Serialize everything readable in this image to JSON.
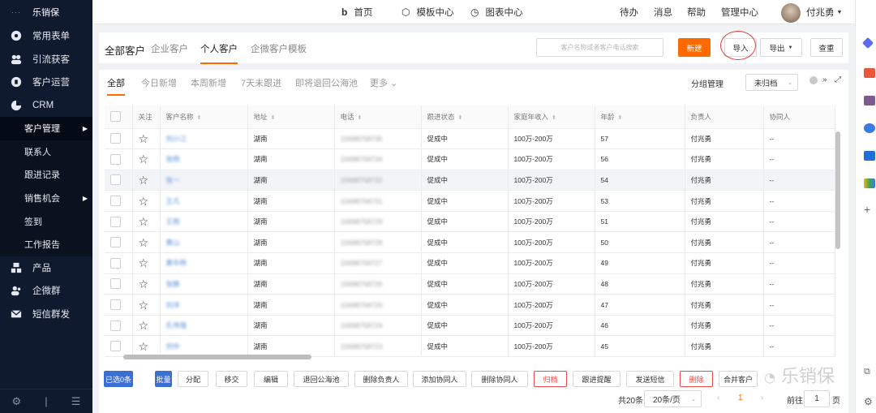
{
  "brand": "乐销保",
  "sidebar": {
    "items": [
      {
        "label": "常用表单",
        "icon": "cog-icon"
      },
      {
        "label": "引流获客",
        "icon": "users-icon"
      },
      {
        "label": "客户运营",
        "icon": "gear-icon"
      },
      {
        "label": "CRM",
        "icon": "pie-icon"
      }
    ],
    "sub": [
      {
        "label": "客户管理",
        "arrow": true,
        "active": true
      },
      {
        "label": "联系人"
      },
      {
        "label": "跟进记录"
      },
      {
        "label": "销售机会",
        "arrow": true
      },
      {
        "label": "签到"
      },
      {
        "label": "工作报告"
      }
    ],
    "items2": [
      {
        "label": "产品",
        "icon": "grid-icon"
      },
      {
        "label": "企微群",
        "icon": "group-icon"
      },
      {
        "label": "短信群发",
        "icon": "mail-icon"
      }
    ]
  },
  "topbar": {
    "home": "首页",
    "templates": "模板中心",
    "charts": "图表中心",
    "todo": "待办",
    "messages": "消息",
    "help": "帮助",
    "admin": "管理中心",
    "user": "付兆勇"
  },
  "tabs": [
    "全部客户",
    "企业客户",
    "个人客户",
    "企微客户模板"
  ],
  "search_placeholder": "客户名称或者客户电话搜索",
  "actions": {
    "new": "新建",
    "import": "导入",
    "export": "导出",
    "dedupe": "查重"
  },
  "filters": [
    "全部",
    "今日新增",
    "本周新增",
    "7天未跟进",
    "即将退回公海池",
    "更多"
  ],
  "group_mgmt": "分组管理",
  "archive_select": "未归档",
  "columns": [
    "关注",
    "客户名称",
    "地址",
    "电话",
    "跟进状态",
    "家庭年收入",
    "年龄",
    "负责人",
    "协同人"
  ],
  "rows": [
    {
      "name": "刘小江",
      "addr": "湖南",
      "phone": "15698758735",
      "status": "促成中",
      "income": "100万-200万",
      "age": "57",
      "owner": "付兆勇",
      "co": "--"
    },
    {
      "name": "张杨",
      "addr": "湖南",
      "phone": "15698758734",
      "status": "促成中",
      "income": "100万-200万",
      "age": "56",
      "owner": "付兆勇",
      "co": "--"
    },
    {
      "name": "张一",
      "addr": "湖南",
      "phone": "15698758732",
      "status": "促成中",
      "income": "100万-200万",
      "age": "54",
      "owner": "付兆勇",
      "co": "--"
    },
    {
      "name": "王凡",
      "addr": "湖南",
      "phone": "15698758731",
      "status": "促成中",
      "income": "100万-200万",
      "age": "53",
      "owner": "付兆勇",
      "co": "--"
    },
    {
      "name": "王雨",
      "addr": "湖南",
      "phone": "15698758729",
      "status": "促成中",
      "income": "100万-200万",
      "age": "51",
      "owner": "付兆勇",
      "co": "--"
    },
    {
      "name": "黄山",
      "addr": "湖南",
      "phone": "15698758728",
      "status": "促成中",
      "income": "100万-200万",
      "age": "50",
      "owner": "付兆勇",
      "co": "--"
    },
    {
      "name": "黄华杨",
      "addr": "湖南",
      "phone": "15698758727",
      "status": "促成中",
      "income": "100万-200万",
      "age": "49",
      "owner": "付兆勇",
      "co": "--"
    },
    {
      "name": "张静",
      "addr": "湖南",
      "phone": "15698758726",
      "status": "促成中",
      "income": "100万-200万",
      "age": "48",
      "owner": "付兆勇",
      "co": "--"
    },
    {
      "name": "刘洋",
      "addr": "湖南",
      "phone": "15698758725",
      "status": "促成中",
      "income": "100万-200万",
      "age": "47",
      "owner": "付兆勇",
      "co": "--"
    },
    {
      "name": "孔伟强",
      "addr": "湖南",
      "phone": "15698758724",
      "status": "促成中",
      "income": "100万-200万",
      "age": "46",
      "owner": "付兆勇",
      "co": "--"
    },
    {
      "name": "刘中",
      "addr": "湖南",
      "phone": "15698758723",
      "status": "促成中",
      "income": "100万-200万",
      "age": "45",
      "owner": "付兆勇",
      "co": "--"
    }
  ],
  "bottom": {
    "selected": "已选0条",
    "batch": "批量",
    "buttons": [
      "分配",
      "移交",
      "编辑",
      "退回公海池",
      "删除负责人",
      "添加协同人",
      "删除协同人",
      "归档",
      "跟进提醒",
      "发送短信",
      "删除",
      "合并客户"
    ]
  },
  "pagination": {
    "total": "共20条",
    "size": "20条/页",
    "current": "1",
    "goto": "前往",
    "page": "1",
    "unit": "页"
  },
  "watermark": "乐销保"
}
